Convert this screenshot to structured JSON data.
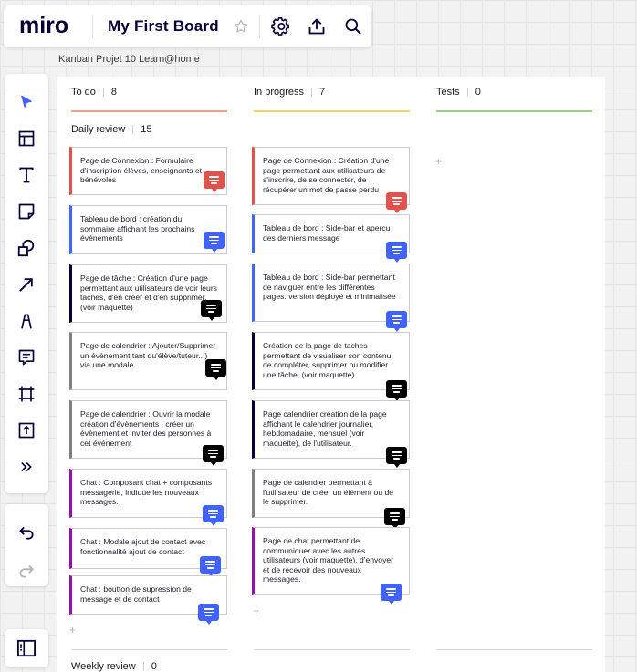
{
  "board": {
    "logo_text": "miro",
    "title": "My First Board",
    "frame_label": "Kanban Projet 10 Learn@home"
  },
  "topbar_icons": [
    "star-icon",
    "gear-icon",
    "upload-icon",
    "search-icon"
  ],
  "toolbar": {
    "tools": [
      "select-icon",
      "template-icon",
      "text-icon",
      "sticky-note-icon",
      "shapes-icon",
      "arrow-icon",
      "pen-icon",
      "comment-icon",
      "frame-icon",
      "upload-icon",
      "more-icon"
    ],
    "undo": "undo-icon",
    "redo": "redo-icon",
    "panel": "panel-icon"
  },
  "colors": {
    "red": "#e0534d",
    "blue": "#4262ff",
    "black": "#050038",
    "gray": "#808080",
    "purple": "#9510ac",
    "todo_line": "#f0a087",
    "progress_line": "#f4d35e",
    "tests_line": "#9bd08a"
  },
  "columns": {
    "todo": {
      "title": "To do",
      "count": "8",
      "subgroup": {
        "title": "Daily review",
        "count": "15"
      },
      "weekly": {
        "title": "Weekly review",
        "count": "0"
      },
      "cards": [
        {
          "text": "Page de Connexion : Formulaire d'inscription élèves, enseignants et bénévoles",
          "color": "red"
        },
        {
          "text": "Tableau de bord : création du sommaire affichant les prochains évènements",
          "color": "blue"
        },
        {
          "text": "Page de tâche : Création d'une page permettant aux utilisateurs de voir leurs tâches, d'en créer et d'en supprimer, (voir maquette)",
          "color": "black"
        },
        {
          "text": "Page de calendrier : Ajouter/Supprimer un évènement tant qu'élève/tuteur...) via une modale",
          "color": "gray"
        },
        {
          "text": "Page de calendrier : Ouvrir la modale création d'évènements , créer un évènement et inviter des personnes à cet événement",
          "color": "gray"
        },
        {
          "text": "Chat : Composant chat + composants messagerie, indique les nouveaux messages.",
          "color": "purple"
        },
        {
          "text": "Chat : Modale ajout de contact avec fonctionnalité ajout de contact",
          "color": "purple"
        },
        {
          "text": "Chat : boutton de supression de message et de contact",
          "color": "purple"
        }
      ]
    },
    "progress": {
      "title": "In progress",
      "count": "7",
      "cards": [
        {
          "text": "Page de Connexion  : Création d'une page permettant aux utilisateurs de s'inscrire, de se connecter, de récupérer un mot de passe perdu",
          "color": "red"
        },
        {
          "text": "Tableau de bord : Side-bar et apercu des derniers message",
          "color": "blue"
        },
        {
          "text": "Tableau de bord : Side-bar permettant de naviguer entre les différentes pages. version déployé et minimalisée",
          "color": "blue"
        },
        {
          "text": "Création de la page de taches permettant de visualiser son contenu, de compléter, supprimer ou modifier une tâche, (voir maquette)",
          "color": "black"
        },
        {
          "text": "Page calendrier création de la page affichant le calendrier journalier, hebdomadaire, mensuel (voir maquette), de l'utilisateur.",
          "color": "black"
        },
        {
          "text": "Page de calendier permettant à l'utilisateur de créer un élément ou de le supprimer.",
          "color": "gray"
        },
        {
          "text": "Page de chat permettant de communiquer avec les autres utilisateurs (voir maquette), d'envoyer et de recevoir des nouveaux messages.",
          "color": "purple"
        }
      ]
    },
    "tests": {
      "title": "Tests",
      "count": "0",
      "cards": []
    }
  },
  "add_symbol": "+"
}
